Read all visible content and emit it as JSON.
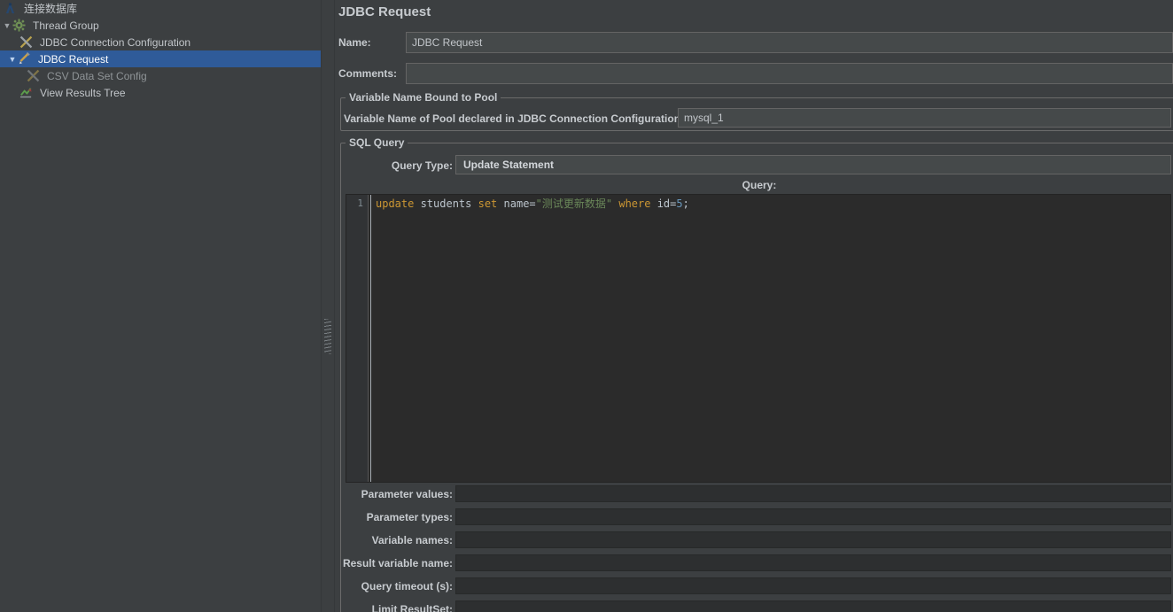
{
  "tree": {
    "items": [
      {
        "label": "连接数据库",
        "icon": "test-plan-icon",
        "selected": false,
        "expanded": true
      },
      {
        "label": "Thread Group",
        "icon": "thread-group-gear-icon",
        "selected": false,
        "expanded": true
      },
      {
        "label": "JDBC Connection Configuration",
        "icon": "jdbc-config-icon",
        "selected": false
      },
      {
        "label": "JDBC Request",
        "icon": "jdbc-sampler-icon",
        "selected": true,
        "expanded": true
      },
      {
        "label": "CSV Data Set Config",
        "icon": "csv-config-icon",
        "selected": false,
        "disabled": true
      },
      {
        "label": "View Results Tree",
        "icon": "results-tree-icon",
        "selected": false
      }
    ]
  },
  "main": {
    "title": "JDBC Request",
    "name": {
      "label": "Name:",
      "value": "JDBC Request"
    },
    "comments": {
      "label": "Comments:",
      "value": ""
    },
    "pool_group": {
      "title": "Variable Name Bound to Pool",
      "pool_label": "Variable Name of Pool declared in JDBC Connection Configuration:",
      "pool_value": "mysql_1"
    },
    "sql_group": {
      "title": "SQL Query",
      "query_type": {
        "label": "Query Type:",
        "value": "Update Statement"
      },
      "query_header": "Query:",
      "editor": {
        "line_number": "1",
        "sql_text": "update students set name=\"测试更新数据\" where id=5;",
        "tokens": [
          {
            "text": "update",
            "type": "keyword"
          },
          {
            "text": " students ",
            "type": "plain"
          },
          {
            "text": "set",
            "type": "keyword"
          },
          {
            "text": " name=",
            "type": "plain"
          },
          {
            "text": "\"测试更新数据\"",
            "type": "string"
          },
          {
            "text": " ",
            "type": "plain"
          },
          {
            "text": "where",
            "type": "keyword"
          },
          {
            "text": " id=",
            "type": "plain"
          },
          {
            "text": "5",
            "type": "number"
          },
          {
            "text": ";",
            "type": "plain"
          }
        ]
      },
      "fields": [
        {
          "label": "Parameter values:",
          "value": ""
        },
        {
          "label": "Parameter types:",
          "value": ""
        },
        {
          "label": "Variable names:",
          "value": ""
        },
        {
          "label": "Result variable name:",
          "value": ""
        },
        {
          "label": "Query timeout (s):",
          "value": ""
        },
        {
          "label": "Limit ResultSet:",
          "value": ""
        }
      ]
    }
  },
  "colors": {
    "panel_bg": "#3c3f41",
    "editor_bg": "#2b2b2b",
    "input_bg": "#45494a",
    "input_border": "#646464",
    "tree_selection": "#2f5b99",
    "sql_keyword": "#cc9733",
    "sql_string": "#6a8759",
    "sql_number": "#6897bb"
  }
}
